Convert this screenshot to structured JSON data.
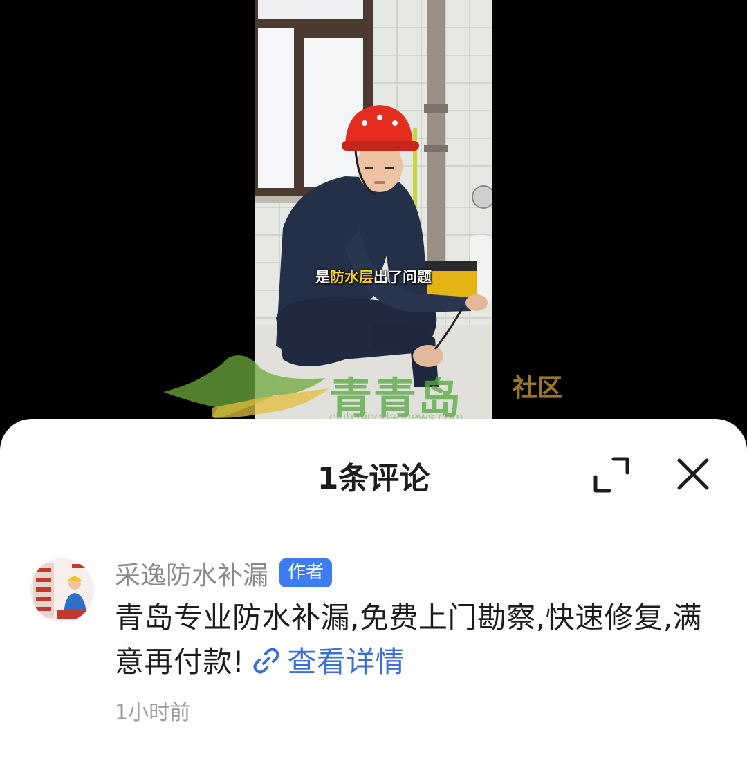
{
  "video": {
    "subtitle_prefix": "是",
    "subtitle_highlight": "防水层",
    "subtitle_suffix": "出了问题",
    "highlight_color": "#ffd21f"
  },
  "watermark": {
    "brand_text": "青青岛",
    "side_text": "社区",
    "url": "club.qingdaonews.com"
  },
  "comments_panel": {
    "title": "1条评论",
    "expand_icon": "expand-icon",
    "close_icon": "close-icon"
  },
  "comments": [
    {
      "author": "采逸防水补漏",
      "badge": "作者",
      "badge_color": "#3f7cf2",
      "text": "青岛专业防水补漏,免费上门勘察,快速修复,满意再付款!",
      "link_icon": "link-icon",
      "link_label": "查看详情",
      "link_color": "#3b6fd8",
      "time": "1小时前"
    }
  ]
}
